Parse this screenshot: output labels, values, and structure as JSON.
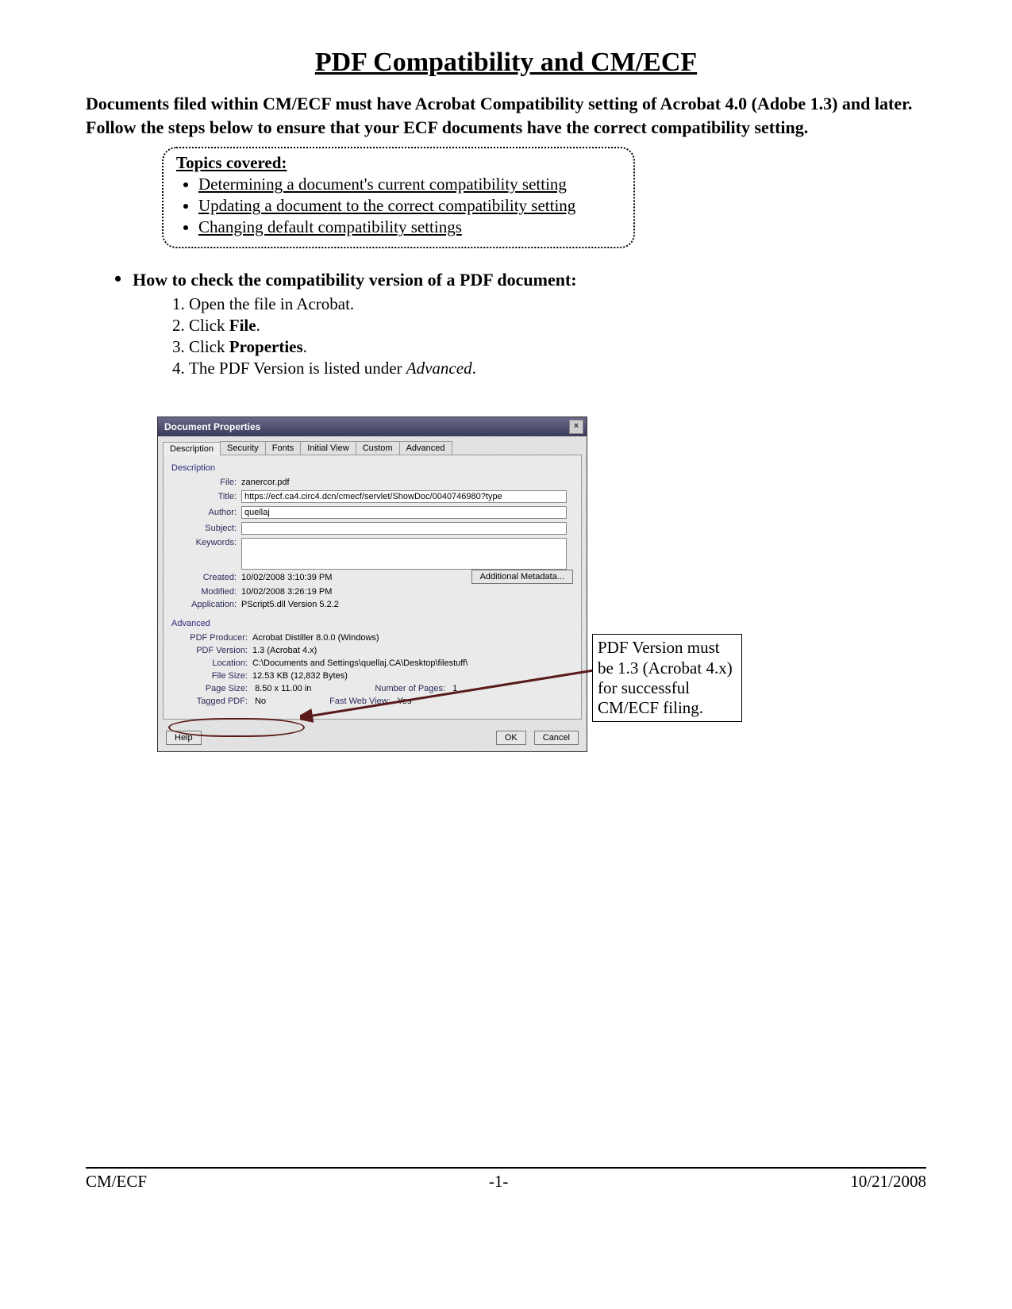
{
  "title": "PDF Compatibility and CM/ECF",
  "intro": "Documents filed within CM/ECF must have Acrobat Compatibility setting of Acrobat 4.0 (Adobe 1.3) and later.  Follow the steps below to ensure that your ECF documents have the correct compatibility setting.",
  "topics_heading": "Topics covered:",
  "topics": [
    "Determining a document's current compatibility setting",
    "Updating a document to the correct compatibility setting",
    "Changing default compatibility settings"
  ],
  "section_heading": "How to check the compatibility version of a PDF document:",
  "steps": {
    "s1a": "Open the file in Acrobat.",
    "s2a": "Click ",
    "s2b": "File",
    "s2c": ".",
    "s3a": "Click ",
    "s3b": "Properties",
    "s3c": ".",
    "s4a": "The PDF Version is listed under ",
    "s4b": "Advanced",
    "s4c": "."
  },
  "dialog": {
    "title": "Document Properties",
    "tabs": [
      "Description",
      "Security",
      "Fonts",
      "Initial View",
      "Custom",
      "Advanced"
    ],
    "group_description": "Description",
    "group_advanced": "Advanced",
    "file_label": "File:",
    "file_value": "zanercor.pdf",
    "title_label": "Title:",
    "title_value": "https://ecf.ca4.circ4.dcn/cmecf/servlet/ShowDoc/0040746980?type",
    "author_label": "Author:",
    "author_value": "quellaj",
    "subject_label": "Subject:",
    "subject_value": "",
    "keywords_label": "Keywords:",
    "keywords_value": "",
    "created_label": "Created:",
    "created_value": "10/02/2008 3:10:39 PM",
    "modified_label": "Modified:",
    "modified_value": "10/02/2008 3:26:19 PM",
    "application_label": "Application:",
    "application_value": "PScript5.dll Version 5.2.2",
    "metadata_button": "Additional Metadata...",
    "producer_label": "PDF Producer:",
    "producer_value": "Acrobat Distiller 8.0.0 (Windows)",
    "version_label": "PDF Version:",
    "version_value": "1.3 (Acrobat 4.x)",
    "location_label": "Location:",
    "location_value": "C:\\Documents and Settings\\quellaj.CA\\Desktop\\filestuff\\",
    "filesize_label": "File Size:",
    "filesize_value": "12.53 KB (12,832 Bytes)",
    "pagesize_label": "Page Size:",
    "pagesize_value": "8.50 x 11.00 in",
    "numpages_label": "Number of Pages:",
    "numpages_value": "1",
    "tagged_label": "Tagged PDF:",
    "tagged_value": "No",
    "fastweb_label": "Fast Web View:",
    "fastweb_value": "Yes",
    "help_button": "Help",
    "ok_button": "OK",
    "cancel_button": "Cancel"
  },
  "annotation": "PDF Version must be 1.3 (Acrobat 4.x) for successful CM/ECF filing.",
  "footer": {
    "left": "CM/ECF",
    "center": "-1-",
    "right": "10/21/2008"
  }
}
